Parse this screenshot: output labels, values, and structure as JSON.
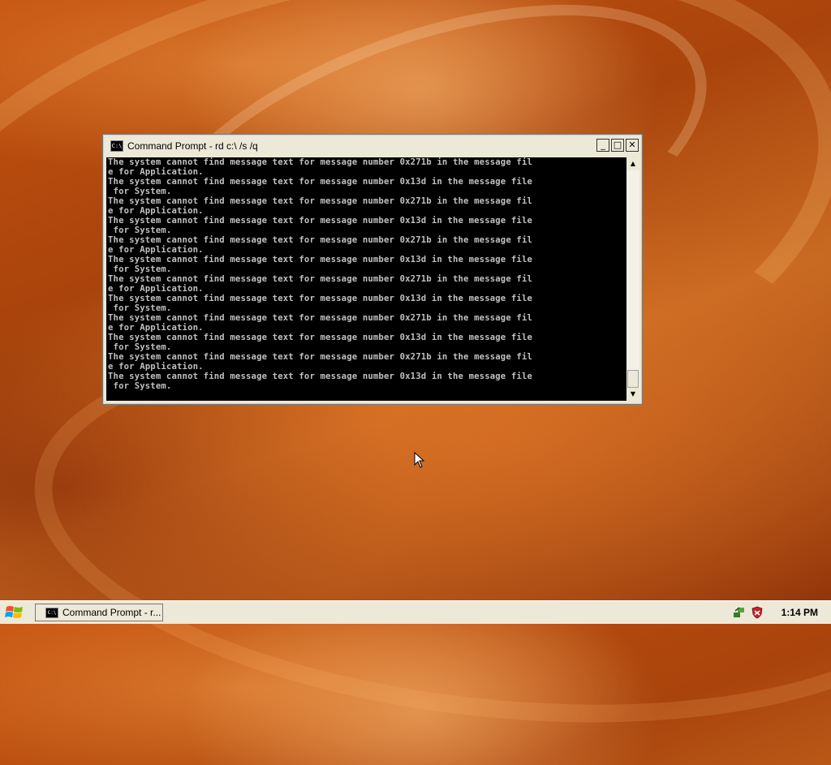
{
  "window": {
    "title": "Command Prompt - rd c:\\ /s /q",
    "icon_label": "C:\\",
    "buttons": {
      "minimize": "_",
      "maximize": "□",
      "close": "✕"
    },
    "console_lines": [
      "The system cannot find message text for message number 0x271b in the message fil",
      "e for Application.",
      "The system cannot find message text for message number 0x13d in the message file",
      " for System.",
      "The system cannot find message text for message number 0x271b in the message fil",
      "e for Application.",
      "The system cannot find message text for message number 0x13d in the message file",
      " for System.",
      "The system cannot find message text for message number 0x271b in the message fil",
      "e for Application.",
      "The system cannot find message text for message number 0x13d in the message file",
      " for System.",
      "The system cannot find message text for message number 0x271b in the message fil",
      "e for Application.",
      "The system cannot find message text for message number 0x13d in the message file",
      " for System.",
      "The system cannot find message text for message number 0x271b in the message fil",
      "e for Application.",
      "The system cannot find message text for message number 0x13d in the message file",
      " for System.",
      "The system cannot find message text for message number 0x271b in the message fil",
      "e for Application.",
      "The system cannot find message text for message number 0x13d in the message file",
      " for System."
    ]
  },
  "taskbar": {
    "task_button_label": "Command Prompt - r...",
    "clock": "1:14 PM",
    "tray_icons": [
      "network-icon",
      "security-shield-icon"
    ]
  },
  "colors": {
    "console_bg": "#000000",
    "console_fg": "#c0c0c0",
    "chrome": "#ece9d8"
  }
}
